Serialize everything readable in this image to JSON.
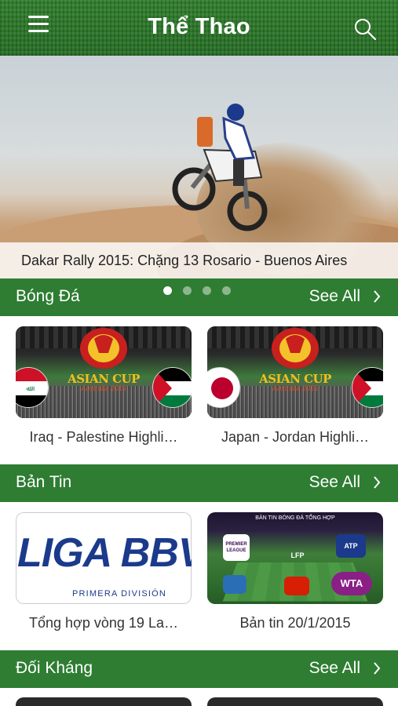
{
  "header": {
    "title": "Thể Thao",
    "menu_icon": "hamburger-menu-icon",
    "search_icon": "search-icon"
  },
  "hero": {
    "caption": "Dakar Rally 2015: Chặng 13 Rosario - Buenos Aires",
    "page_indicator": {
      "count": 4,
      "active_index": 0
    }
  },
  "sections": [
    {
      "title": "Bóng Đá",
      "see_all": "See All",
      "items": [
        {
          "label": "Iraq - Palestine Highli…"
        },
        {
          "label": "Japan - Jordan Highli…"
        }
      ]
    },
    {
      "title": "Bản Tin",
      "see_all": "See All",
      "items": [
        {
          "label": "Tổng hợp vòng 19 La…"
        },
        {
          "label": "Bản tin 20/1/2015"
        }
      ]
    },
    {
      "title": "Đối Kháng",
      "see_all": "See All",
      "items": []
    }
  ],
  "thumbs": {
    "asian_cup": {
      "title": "ASIAN CUP",
      "subtitle": "Australia 2015"
    },
    "liga": {
      "wordmark": "LIGA BBV",
      "subtitle": "PRIMERA DIVISIÓN"
    },
    "ban_tin": {
      "heading": "BẢN TIN BÓNG ĐÁ TỔNG HỢP",
      "logos": [
        "PREMIER LEAGUE",
        "LFP",
        "ATP",
        "WTA"
      ]
    }
  },
  "colors": {
    "header_green": "#2a7627",
    "section_green": "#2e7d32",
    "text_dark": "#333333",
    "white": "#ffffff"
  }
}
